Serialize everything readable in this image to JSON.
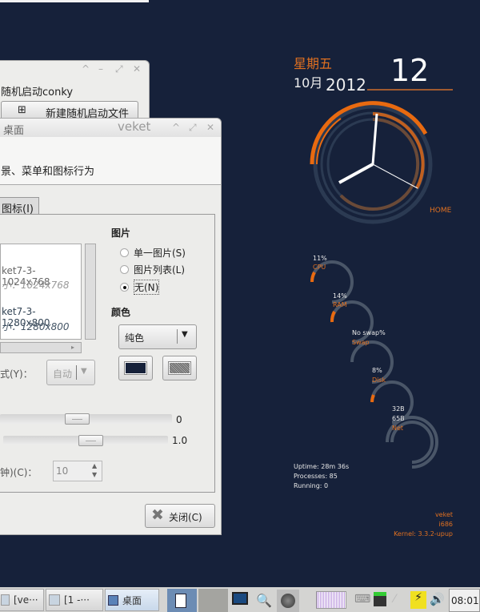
{
  "back_window": {
    "group_label": "随机启动conky",
    "new_button": "新建随机启动文件"
  },
  "front_window": {
    "title": "桌面",
    "wm_name": "veket",
    "header_text": "景、菜单和图标行为",
    "tab_label": "图标(I)",
    "list_items": [
      {
        "name": "ket7-3-1024x768",
        "size": "小：1024x768"
      },
      {
        "name": "ket7-3-1280x800",
        "size": "小：1280x800"
      }
    ],
    "picture_label": "图片",
    "radios": [
      {
        "label": "单一图片(S)",
        "checked": false
      },
      {
        "label": "图片列表(L)",
        "checked": false
      },
      {
        "label": "无(N)",
        "checked": true
      }
    ],
    "color_label": "颜色",
    "color_mode": "纯色",
    "style_label": "式(Y)：",
    "style_value": "自动",
    "slider1_value": "0",
    "slider2_value": "1.0",
    "interval_label": "钟)(C)：",
    "interval_value": "10",
    "close_button": "关闭(C)",
    "primary_color": "#16213a"
  },
  "conky": {
    "weekday": "星期五",
    "month": "10月",
    "year": "2012",
    "day": "12",
    "home": "HOME",
    "meters": [
      {
        "value": "11%",
        "label": "CPU",
        "fraction": 0.11
      },
      {
        "value": "14%",
        "label": "RAM",
        "fraction": 0.14
      },
      {
        "value": "No swap%",
        "label": "Swap",
        "fraction": 0
      },
      {
        "value": "8%",
        "label": "Disk",
        "fraction": 0.08
      }
    ],
    "net": {
      "up": "32B",
      "down": "65B",
      "label": "Net"
    },
    "uptime": "Uptime: 28m 36s",
    "processes": "Processes: 85",
    "running": "Running: 0",
    "host": "veket",
    "arch": "i686",
    "kernel": "Kernel: 3.3.2-upup",
    "accent": "#e07020"
  },
  "taskbar": {
    "tasks": [
      "[ve···",
      "[1 -···",
      "桌面"
    ],
    "clock": "08:01"
  }
}
